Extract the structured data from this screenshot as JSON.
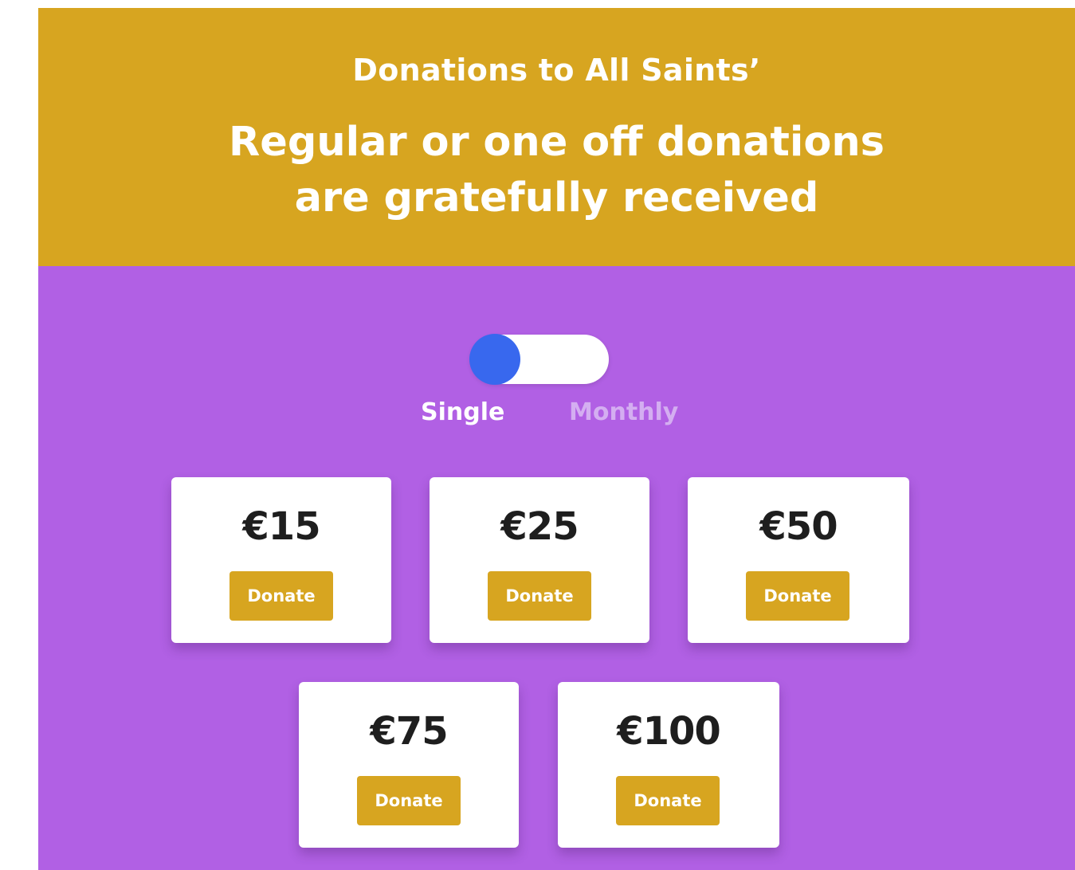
{
  "header": {
    "kicker": "Donations to All Saints’",
    "headline_line1": "Regular or one off donations",
    "headline_line2": "are gratefully received"
  },
  "frequency_toggle": {
    "selected": "Single",
    "options": [
      "Single",
      "Monthly"
    ]
  },
  "donation_options": [
    {
      "amount": "€15",
      "button_label": "Donate"
    },
    {
      "amount": "€25",
      "button_label": "Donate"
    },
    {
      "amount": "€50",
      "button_label": "Donate"
    },
    {
      "amount": "€75",
      "button_label": "Donate"
    },
    {
      "amount": "€100",
      "button_label": "Donate"
    }
  ],
  "colors": {
    "header_bg": "#D7A520",
    "body_bg": "#B160E4",
    "toggle_knob": "#3868EE",
    "button_bg": "#D7A520",
    "inactive_label": "#D4AEF1"
  }
}
